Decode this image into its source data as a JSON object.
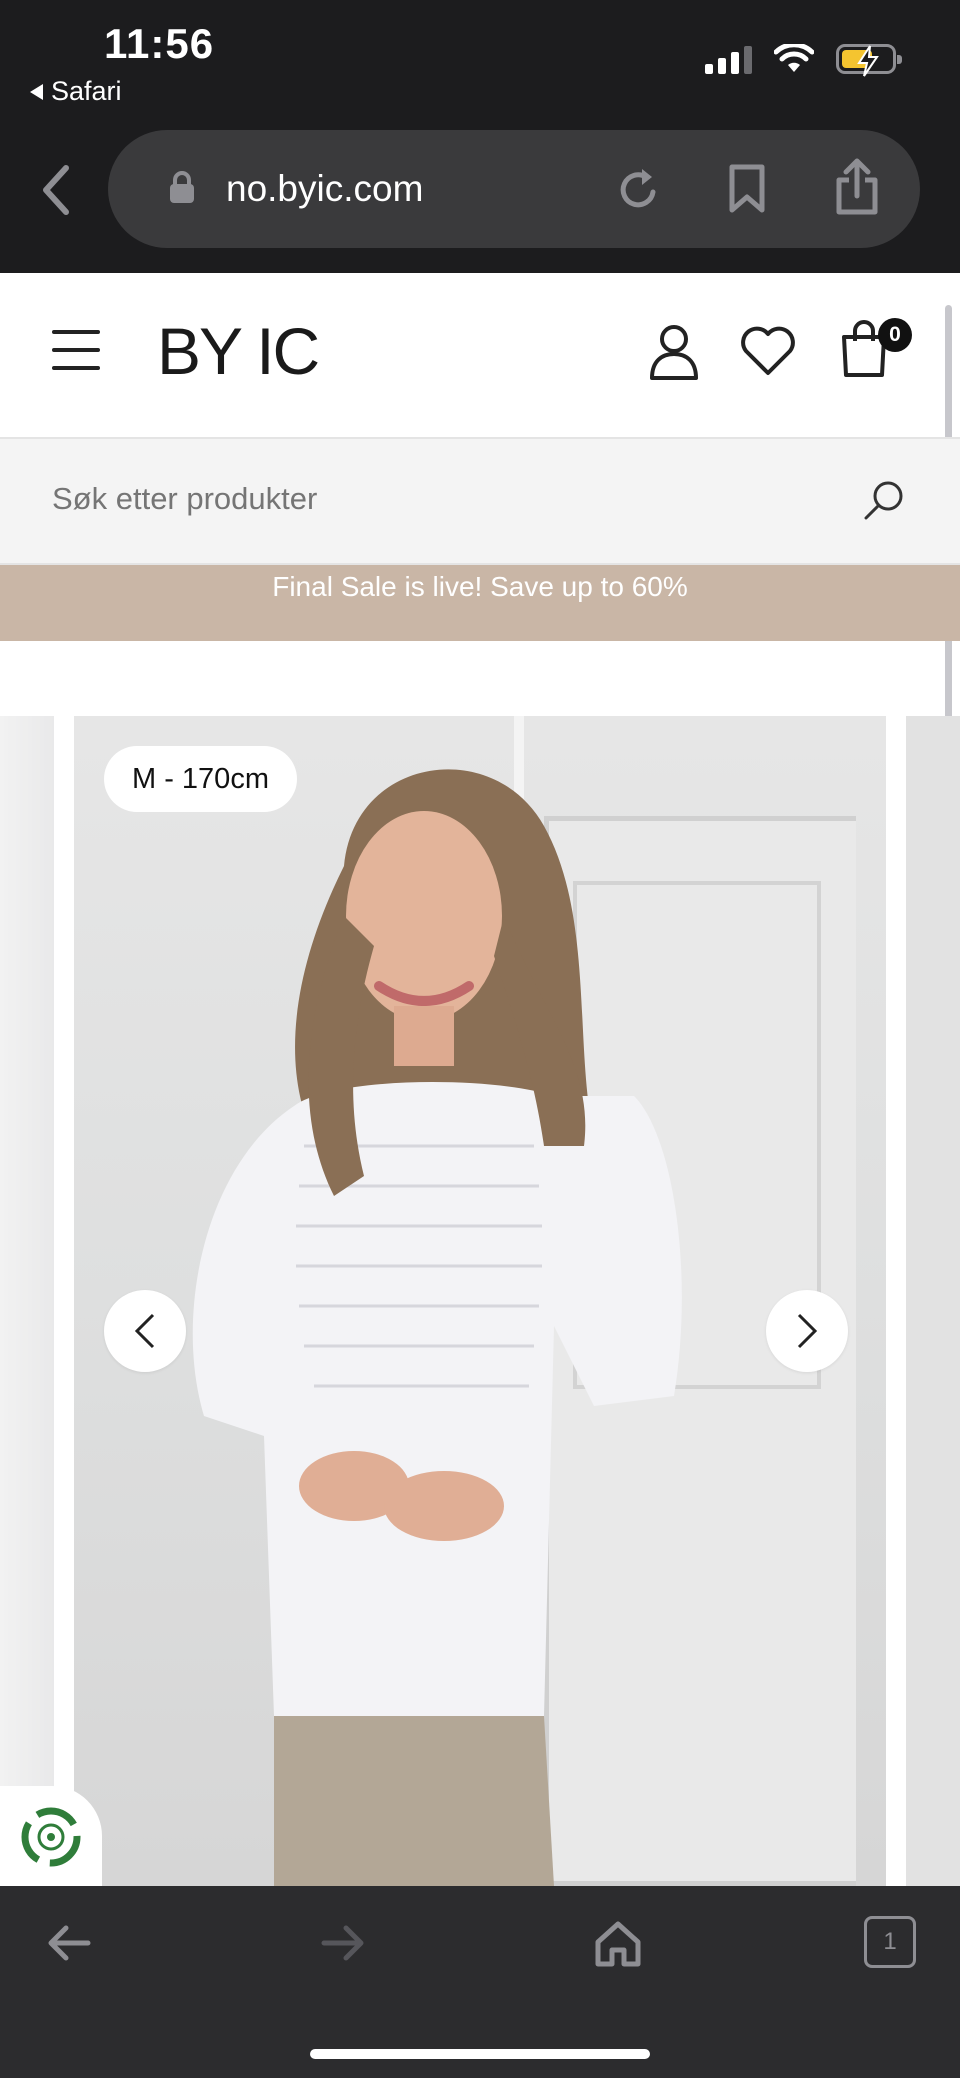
{
  "status_bar": {
    "time": "11:56",
    "back_app_label": "Safari",
    "battery_state": "charging",
    "icons": [
      "signal-icon",
      "wifi-icon",
      "battery-icon"
    ]
  },
  "browser": {
    "url": "no.byic.com",
    "tab_count": "1"
  },
  "header": {
    "logo": "BY IC",
    "cart_count": "0"
  },
  "search": {
    "placeholder": "Søk etter produkter"
  },
  "promo": {
    "text": "Final Sale is live! Save up to 60%"
  },
  "carousel": {
    "size_label": "M - 170cm"
  },
  "colors": {
    "promo_bg": "#c9b6a6",
    "browser_chrome": "#1c1c1e",
    "toolbar": "#2c2c2e",
    "battery_fill": "#f4c430"
  }
}
